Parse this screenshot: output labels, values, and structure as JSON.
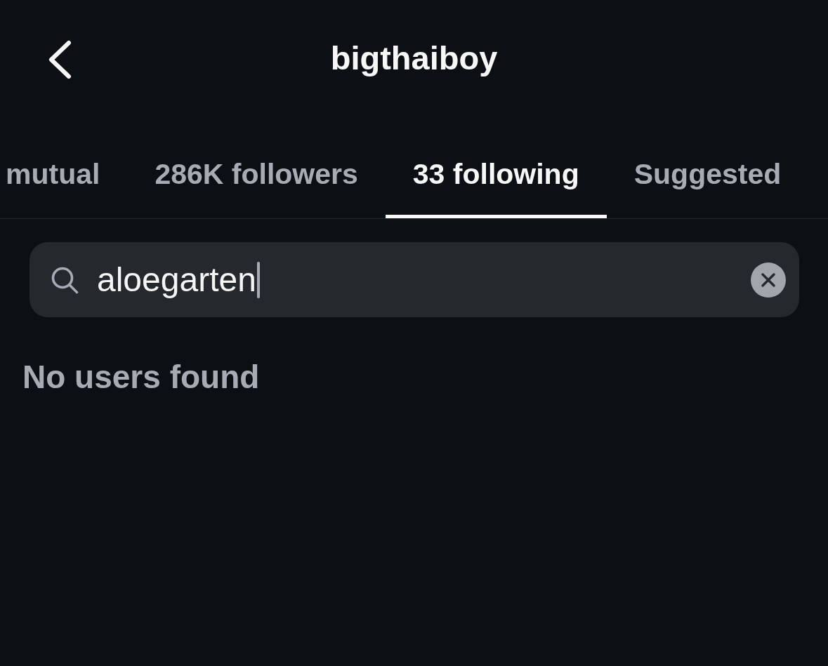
{
  "header": {
    "title": "bigthaiboy"
  },
  "tabs": [
    {
      "label": "mutual",
      "selected": false
    },
    {
      "label": "286K followers",
      "selected": false
    },
    {
      "label": "33 following",
      "selected": true
    },
    {
      "label": "Suggested",
      "selected": false
    }
  ],
  "search": {
    "value": "aloegarten",
    "focused": true
  },
  "empty_state": {
    "message": "No users found"
  }
}
